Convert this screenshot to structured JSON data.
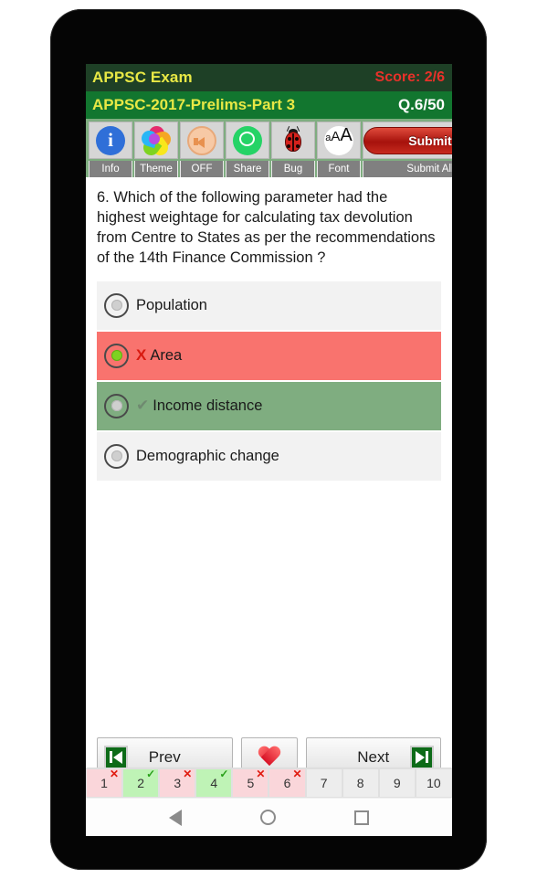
{
  "app": {
    "title": "APPSC Exam",
    "score_label": "Score: 2/6"
  },
  "exam": {
    "paper_title": "APPSC-2017-Prelims-Part 3",
    "question_counter": "Q.6/50"
  },
  "toolbar": [
    {
      "label": "Info",
      "icon": "info-icon"
    },
    {
      "label": "Theme",
      "icon": "theme-palette-icon"
    },
    {
      "label": "OFF",
      "icon": "speaker-icon"
    },
    {
      "label": "Share",
      "icon": "whatsapp-share-icon"
    },
    {
      "label": "Bug",
      "icon": "ladybug-icon"
    },
    {
      "label": "Font",
      "icon": "font-size-icon"
    },
    {
      "label": "Submit All",
      "icon": "submit-button",
      "button_label": "Submit"
    }
  ],
  "question": {
    "number": "6.",
    "text": "6. Which of the following parameter had the highest weightage for calculating tax devolution from Centre to States as per the recommendations of the 14th Finance Commission ?"
  },
  "options": [
    {
      "label": "Population",
      "state": "neutral",
      "selected": false,
      "mark": ""
    },
    {
      "label": "Area",
      "state": "wrong",
      "selected": true,
      "mark": "X"
    },
    {
      "label": "Income distance",
      "state": "right",
      "selected": false,
      "mark": "✔"
    },
    {
      "label": "Demographic change",
      "state": "neutral",
      "selected": false,
      "mark": ""
    }
  ],
  "nav": {
    "prev_label": "Prev",
    "next_label": "Next",
    "favorite_icon": "heart-icon",
    "prev_icon": "skip-previous-icon",
    "next_icon": "skip-next-icon"
  },
  "question_strip": [
    {
      "number": "1",
      "state": "wrong",
      "badge": "✕"
    },
    {
      "number": "2",
      "state": "correct",
      "badge": "✓"
    },
    {
      "number": "3",
      "state": "wrong",
      "badge": "✕"
    },
    {
      "number": "4",
      "state": "correct",
      "badge": "✓"
    },
    {
      "number": "5",
      "state": "wrong",
      "badge": "✕"
    },
    {
      "number": "6",
      "state": "wrong",
      "badge": "✕"
    },
    {
      "number": "7",
      "state": "unanswered",
      "badge": ""
    },
    {
      "number": "8",
      "state": "unanswered",
      "badge": ""
    },
    {
      "number": "9",
      "state": "unanswered",
      "badge": ""
    },
    {
      "number": "10",
      "state": "unanswered",
      "badge": ""
    }
  ],
  "system_nav": {
    "back": "back-icon",
    "home": "home-icon",
    "recent": "recent-apps-icon"
  },
  "colors": {
    "appbar": "#1e4026",
    "subbar": "#12762f",
    "accent_yellow": "#e8e845",
    "score_red": "#e8312a",
    "toolbar_bg": "#7fad80",
    "wrong_row": "#f9736e",
    "right_row": "#7fad80",
    "neutral_row": "#f2f2f2",
    "submit_red": "#a6120c"
  }
}
